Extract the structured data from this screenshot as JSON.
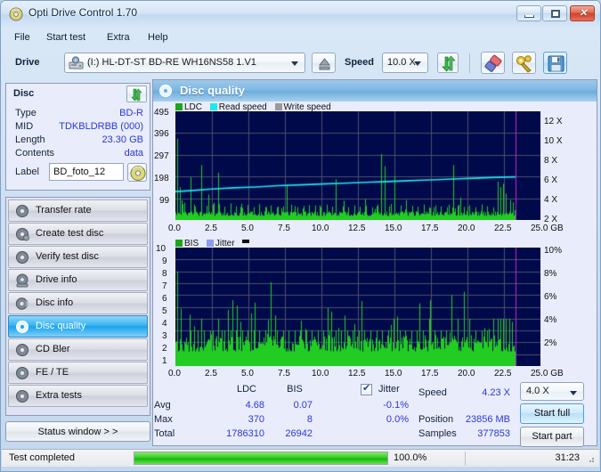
{
  "window": {
    "title": "Opti Drive Control 1.70",
    "icon": "disc-icon",
    "buttons": {
      "minimize": "minimize",
      "maximize": "maximize",
      "close": "✕"
    }
  },
  "menu": [
    {
      "label": "File"
    },
    {
      "label": "Start test"
    },
    {
      "label": "Extra"
    },
    {
      "label": "Help"
    }
  ],
  "toolbar": {
    "drive_label": "Drive",
    "drive_value": "(I:)   HL-DT-ST BD-RE  WH16NS58 1.V1",
    "speed_label": "Speed",
    "speed_value": "10.0 X",
    "icons": {
      "drive": "drive-icon",
      "eject": "eject-icon",
      "refresh": "refresh-icon",
      "erase": "erase-icon",
      "tools": "tools-icon",
      "save": "save-icon"
    }
  },
  "disc": {
    "header": "Disc",
    "reload_icon": "refresh-icon",
    "rows": [
      {
        "key": "Type",
        "value": "BD-R"
      },
      {
        "key": "MID",
        "value": "TDKBLDRBB (000)"
      },
      {
        "key": "Length",
        "value": "23.30 GB"
      },
      {
        "key": "Contents",
        "value": "data"
      }
    ],
    "label_key": "Label",
    "label_value": "BD_foto_12",
    "disc_button_icon": "disc-icon"
  },
  "nav": {
    "items": [
      {
        "label": "Transfer rate",
        "icon": "transfer-rate-icon",
        "active": false
      },
      {
        "label": "Create test disc",
        "icon": "create-test-disc-icon",
        "active": false
      },
      {
        "label": "Verify test disc",
        "icon": "verify-test-disc-icon",
        "active": false
      },
      {
        "label": "Drive info",
        "icon": "drive-info-icon",
        "active": false
      },
      {
        "label": "Disc info",
        "icon": "disc-info-icon",
        "active": false
      },
      {
        "label": "Disc quality",
        "icon": "disc-quality-icon",
        "active": true
      },
      {
        "label": "CD Bler",
        "icon": "cd-bler-icon",
        "active": false
      },
      {
        "label": "FE / TE",
        "icon": "fe-te-icon",
        "active": false
      },
      {
        "label": "Extra tests",
        "icon": "extra-tests-icon",
        "active": false
      }
    ],
    "status_window_label": "Status window > >"
  },
  "panel": {
    "title": "Disc quality",
    "icon": "disc-quality-icon"
  },
  "stats": {
    "col_ldc": "LDC",
    "col_bis": "BIS",
    "jitter_label": "Jitter",
    "jitter_checked": true,
    "rows": [
      {
        "name": "Avg",
        "ldc": "4.68",
        "bis": "0.07",
        "jitter": "-0.1%"
      },
      {
        "name": "Max",
        "ldc": "370",
        "bis": "8",
        "jitter": "0.0%"
      },
      {
        "name": "Total",
        "ldc": "1786310",
        "bis": "26942",
        "jitter": ""
      }
    ],
    "speed_label": "Speed",
    "speed_value": "4.23 X",
    "position_label": "Position",
    "position_value": "23856 MB",
    "samples_label": "Samples",
    "samples_value": "377853",
    "speed_select": "4.0 X",
    "start_full": "Start full",
    "start_part": "Start part"
  },
  "statusbar": {
    "text": "Test completed",
    "progress": "100.0%",
    "progress_value": 100,
    "elapsed": "31:23"
  },
  "chart_data": [
    {
      "type": "line",
      "id": "quality-chart",
      "title": "",
      "xlabel": "GB",
      "ylabel": "",
      "xlim": [
        0,
        25.0
      ],
      "ylim": [
        0,
        495
      ],
      "y2lim": [
        0,
        13
      ],
      "xticks": [
        "0.0",
        "2.5",
        "5.0",
        "7.5",
        "10.0",
        "12.5",
        "15.0",
        "17.5",
        "20.0",
        "22.5",
        "25.0 GB"
      ],
      "yticks": [
        "495",
        "396",
        "297",
        "198",
        "99"
      ],
      "y2ticks": [
        "12 X",
        "10 X",
        "8 X",
        "6 X",
        "4 X",
        "2 X"
      ],
      "grid": true,
      "legend": [
        {
          "name": "LDC",
          "color": "#1aa81a"
        },
        {
          "name": "Read speed",
          "color": "#1fe8f0"
        },
        {
          "name": "Write speed",
          "color": "#9a9a9a"
        }
      ],
      "data_end_gb": 23.3,
      "series": [
        {
          "name": "LDC",
          "color": "#22cc22",
          "kind": "spikes",
          "baseline": 30,
          "peaks": [
            [
              0.12,
              370
            ],
            [
              0.3,
              150
            ],
            [
              0.45,
              90
            ],
            [
              0.62,
              70
            ],
            [
              1.05,
              195
            ],
            [
              1.35,
              60
            ],
            [
              1.75,
              250
            ],
            [
              2.15,
              65
            ],
            [
              2.55,
              70
            ],
            [
              2.95,
              215
            ],
            [
              3.35,
              60
            ],
            [
              3.75,
              75
            ],
            [
              4.15,
              62
            ],
            [
              4.55,
              55
            ],
            [
              4.95,
              68
            ],
            [
              5.35,
              58
            ],
            [
              5.75,
              72
            ],
            [
              6.15,
              60
            ],
            [
              6.55,
              66
            ],
            [
              6.95,
              58
            ],
            [
              7.35,
              62
            ],
            [
              7.62,
              160
            ],
            [
              7.95,
              70
            ],
            [
              8.35,
              58
            ],
            [
              8.75,
              64
            ],
            [
              9.15,
              60
            ],
            [
              9.55,
              66
            ],
            [
              9.95,
              58
            ],
            [
              10.35,
              70
            ],
            [
              10.75,
              60
            ],
            [
              11.0,
              185
            ],
            [
              11.45,
              62
            ],
            [
              11.85,
              58
            ],
            [
              12.25,
              66
            ],
            [
              12.65,
              60
            ],
            [
              13.05,
              64
            ],
            [
              13.45,
              58
            ],
            [
              13.85,
              70
            ],
            [
              14.1,
              300
            ],
            [
              14.3,
              245
            ],
            [
              14.65,
              62
            ],
            [
              15.0,
              200
            ],
            [
              15.4,
              66
            ],
            [
              15.8,
              58
            ],
            [
              16.2,
              64
            ],
            [
              16.6,
              60
            ],
            [
              17.0,
              70
            ],
            [
              17.4,
              58
            ],
            [
              17.8,
              66
            ],
            [
              18.2,
              62
            ],
            [
              18.6,
              58
            ],
            [
              19.0,
              250
            ],
            [
              19.35,
              64
            ],
            [
              19.75,
              60
            ],
            [
              20.15,
              66
            ],
            [
              20.55,
              58
            ],
            [
              20.95,
              70
            ],
            [
              21.35,
              62
            ],
            [
              21.75,
              58
            ],
            [
              22.05,
              175
            ],
            [
              22.25,
              150
            ],
            [
              22.45,
              165
            ],
            [
              22.65,
              120
            ],
            [
              22.9,
              90
            ],
            [
              23.1,
              80
            ]
          ]
        },
        {
          "name": "Read speed",
          "color": "#1fe8f0",
          "kind": "line",
          "points": [
            [
              0.0,
              3.4
            ],
            [
              1.0,
              3.5
            ],
            [
              2.5,
              3.7
            ],
            [
              4.0,
              3.85
            ],
            [
              5.5,
              3.95
            ],
            [
              7.0,
              4.1
            ],
            [
              8.5,
              4.2
            ],
            [
              10.0,
              4.3
            ],
            [
              11.5,
              4.4
            ],
            [
              13.0,
              4.5
            ],
            [
              14.5,
              4.6
            ],
            [
              16.0,
              4.7
            ],
            [
              17.5,
              4.8
            ],
            [
              19.0,
              4.9
            ],
            [
              20.5,
              5.0
            ],
            [
              22.0,
              5.1
            ],
            [
              23.3,
              5.15
            ]
          ]
        }
      ]
    },
    {
      "type": "bar",
      "id": "bis-chart",
      "title": "",
      "xlabel": "GB",
      "ylabel": "",
      "xlim": [
        0,
        25.0
      ],
      "ylim": [
        0,
        10
      ],
      "y2lim": [
        0,
        11
      ],
      "xticks": [
        "0.0",
        "2.5",
        "5.0",
        "7.5",
        "10.0",
        "12.5",
        "15.0",
        "17.5",
        "20.0",
        "22.5",
        "25.0 GB"
      ],
      "yticks": [
        "10",
        "9",
        "8",
        "7",
        "6",
        "5",
        "4",
        "3",
        "2",
        "1"
      ],
      "y2ticks": [
        "10%",
        "8%",
        "6%",
        "4%",
        "2%"
      ],
      "grid": true,
      "legend": [
        {
          "name": "BIS",
          "color": "#1aa81a"
        },
        {
          "name": "Jitter",
          "color": "#8c9cf0"
        }
      ],
      "data_end_gb": 23.3,
      "series": [
        {
          "name": "BIS",
          "color": "#22cc22",
          "kind": "spikes",
          "baseline": 2,
          "peaks": [
            [
              0.1,
              8
            ],
            [
              0.35,
              3
            ],
            [
              1.05,
              3
            ],
            [
              1.25,
              3
            ],
            [
              1.55,
              3
            ],
            [
              1.75,
              4
            ],
            [
              1.95,
              3
            ],
            [
              2.35,
              3
            ],
            [
              2.55,
              3
            ],
            [
              2.95,
              4
            ],
            [
              3.15,
              3
            ],
            [
              3.35,
              3
            ],
            [
              3.75,
              3
            ],
            [
              4.15,
              3
            ],
            [
              4.55,
              3
            ],
            [
              4.95,
              3
            ],
            [
              5.35,
              3
            ],
            [
              5.75,
              3
            ],
            [
              6.15,
              3
            ],
            [
              6.55,
              3
            ],
            [
              6.95,
              3
            ],
            [
              7.35,
              3
            ],
            [
              7.75,
              3
            ],
            [
              8.15,
              3
            ],
            [
              8.55,
              3
            ],
            [
              8.95,
              3
            ],
            [
              9.35,
              3
            ],
            [
              9.75,
              3
            ],
            [
              10.15,
              3
            ],
            [
              10.55,
              3
            ],
            [
              10.95,
              3
            ],
            [
              11.35,
              3
            ],
            [
              11.75,
              3
            ],
            [
              12.15,
              3
            ],
            [
              12.55,
              3
            ],
            [
              12.95,
              3
            ],
            [
              13.35,
              3
            ],
            [
              13.75,
              3
            ],
            [
              14.15,
              3
            ],
            [
              14.55,
              3
            ],
            [
              14.95,
              4
            ],
            [
              15.35,
              3
            ],
            [
              15.75,
              3
            ],
            [
              16.15,
              3
            ],
            [
              16.55,
              3
            ],
            [
              16.95,
              3
            ],
            [
              17.35,
              3
            ],
            [
              17.75,
              3
            ],
            [
              18.15,
              3
            ],
            [
              18.55,
              3
            ],
            [
              18.9,
              6
            ],
            [
              19.35,
              4
            ],
            [
              19.75,
              3
            ],
            [
              20.15,
              4
            ],
            [
              20.55,
              3
            ],
            [
              20.95,
              3
            ],
            [
              21.35,
              3
            ],
            [
              21.75,
              4
            ],
            [
              22.05,
              4
            ],
            [
              22.25,
              4
            ],
            [
              22.45,
              4
            ],
            [
              22.65,
              4
            ],
            [
              22.85,
              4
            ],
            [
              23.05,
              3
            ]
          ]
        }
      ]
    }
  ]
}
